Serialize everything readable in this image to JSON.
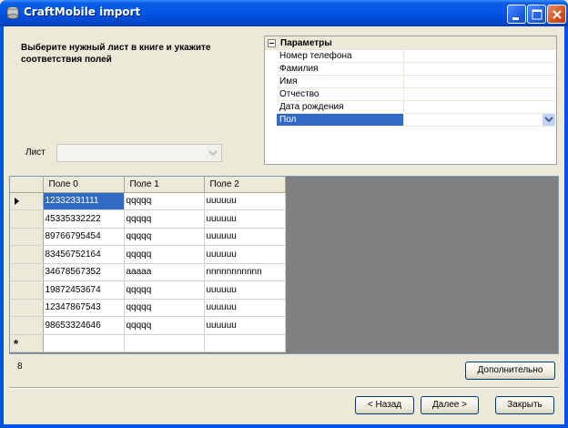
{
  "window": {
    "title": "CraftMobile import"
  },
  "instruction": "Выберите нужный лист в книге и укажите соответствия полей",
  "sheet": {
    "label": "Лист",
    "value": ""
  },
  "parameters": {
    "category": "Параметры",
    "items": [
      {
        "name": "Номер телефона",
        "value": ""
      },
      {
        "name": "Фамилия",
        "value": ""
      },
      {
        "name": "Имя",
        "value": ""
      },
      {
        "name": "Отчество",
        "value": ""
      },
      {
        "name": "Дата рождения",
        "value": ""
      },
      {
        "name": "Пол",
        "value": ""
      }
    ]
  },
  "grid": {
    "columns": [
      "Поле 0",
      "Поле 1",
      "Поле 2"
    ],
    "rows": [
      [
        "12332331111",
        "qqqqq",
        "uuuuuu"
      ],
      [
        "45335332222",
        "qqqqq",
        "uuuuuu"
      ],
      [
        "89766795454",
        "qqqqq",
        "uuuuuu"
      ],
      [
        "83456752164",
        "qqqqq",
        "uuuuuu"
      ],
      [
        "34678567352",
        "aaaaa",
        "nnnnnnnnnnn"
      ],
      [
        "19872453674",
        "qqqqq",
        "uuuuuu"
      ],
      [
        "12347867543",
        "qqqqq",
        "uuuuuu"
      ],
      [
        "98653324646",
        "qqqqq",
        "uuuuuu"
      ]
    ],
    "new_row_marker": "*"
  },
  "row_count": "8",
  "buttons": {
    "more": "Дополнительно",
    "back": "< Назад",
    "next": "Далее >",
    "close": "Закрыть"
  },
  "colors": {
    "titlebar": "#0054e3",
    "selection": "#316ac5",
    "dialog_bg": "#ece9d8"
  }
}
